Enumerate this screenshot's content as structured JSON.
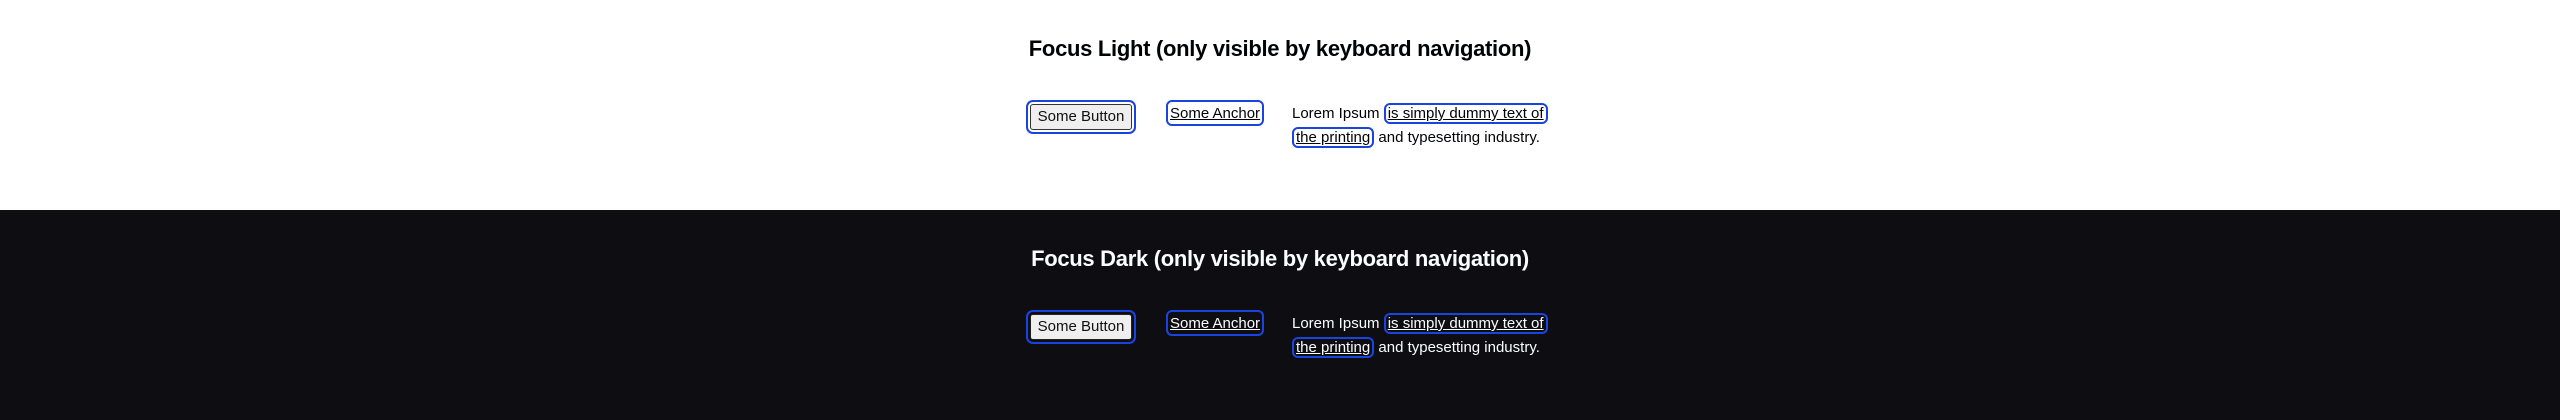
{
  "light": {
    "title": "Focus Light (only visible by keyboard navigation)",
    "button_label": "Some Button",
    "anchor_label": "Some Anchor",
    "para_before": "Lorem Ipsum ",
    "para_link": "is simply dummy text of the printing",
    "para_after": " and typesetting industry."
  },
  "dark": {
    "title": "Focus Dark (only visible by keyboard navigation)",
    "button_label": "Some Button",
    "anchor_label": "Some Anchor",
    "para_before": "Lorem Ipsum ",
    "para_link": "is simply dummy text of the printing",
    "para_after": " and typesetting industry."
  },
  "colors": {
    "light_bg": "#ffffff",
    "dark_bg": "#0e0e12",
    "focus_ring": "#1a44e0"
  }
}
